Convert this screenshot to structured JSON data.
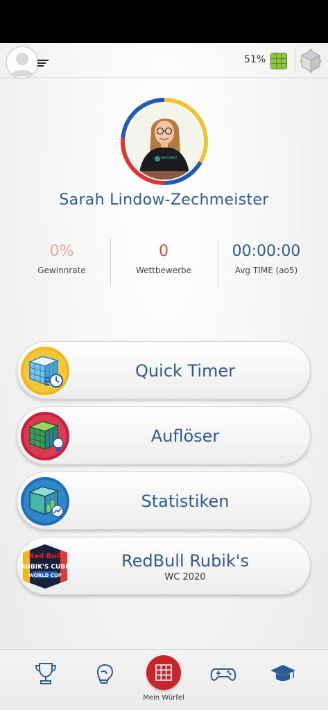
{
  "status": {
    "battery_percent": "51%"
  },
  "profile": {
    "name": "Sarah Lindow-Zechmeister",
    "shirt_text": "ARDUINO"
  },
  "stats": [
    {
      "value": "0%",
      "label": "Gewinnrate",
      "color": "#f1a48c"
    },
    {
      "value": "0",
      "label": "Wettbewerbe",
      "color": "#e0473a"
    },
    {
      "value": "00:00:00",
      "label": "Avg TIME (ao5)",
      "color": "#2a5d95"
    }
  ],
  "menu": {
    "quick_timer": "Quick Timer",
    "solver": "Auflöser",
    "statistics": "Statistiken",
    "redbull_title": "RedBull Rubik's",
    "redbull_sub": "WC 2020"
  },
  "redbull_logo": {
    "line1": "Red Bull",
    "line2": "RUBIK'S CUBE",
    "line3": "WORLD CUP"
  },
  "bottom_nav": {
    "items": [
      "trophy-icon",
      "boxing-glove-icon",
      "cube-icon",
      "gamepad-icon",
      "graduation-cap-icon"
    ],
    "active_label": "Mein Würfel"
  },
  "colors": {
    "accent": "#2a5d95",
    "active_nav": "#c7262b",
    "ring_yellow": "#f2c12e",
    "ring_blue": "#1f5bb5",
    "ring_red": "#e2342d"
  }
}
